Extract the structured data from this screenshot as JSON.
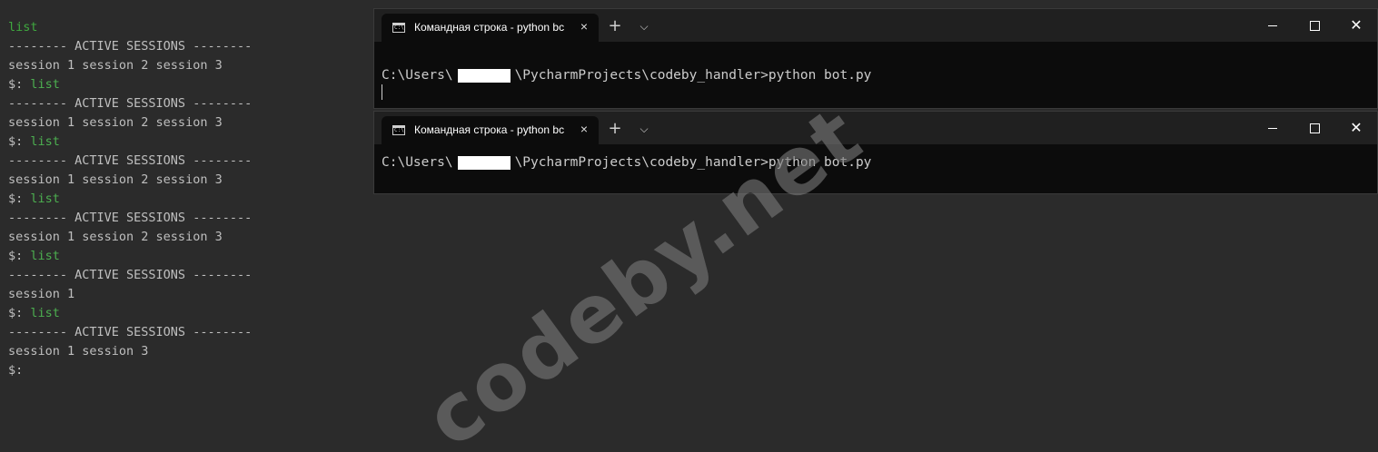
{
  "console": {
    "lines": [
      {
        "prefix": "",
        "text": "list",
        "style": "cmd-green"
      },
      {
        "prefix": "",
        "text": "-------- ACTIVE SESSIONS --------",
        "style": "plain"
      },
      {
        "prefix": "",
        "text": "session 1 session 2 session 3",
        "style": "plain"
      },
      {
        "prefix": "$: ",
        "text": "list",
        "style": "prompt"
      },
      {
        "prefix": "",
        "text": "-------- ACTIVE SESSIONS --------",
        "style": "plain"
      },
      {
        "prefix": "",
        "text": "session 1 session 2 session 3",
        "style": "plain"
      },
      {
        "prefix": "$: ",
        "text": "list",
        "style": "prompt"
      },
      {
        "prefix": "",
        "text": "-------- ACTIVE SESSIONS --------",
        "style": "plain"
      },
      {
        "prefix": "",
        "text": "session 1 session 2 session 3",
        "style": "plain"
      },
      {
        "prefix": "$: ",
        "text": "list",
        "style": "prompt"
      },
      {
        "prefix": "",
        "text": "-------- ACTIVE SESSIONS --------",
        "style": "plain"
      },
      {
        "prefix": "",
        "text": "session 1 session 2 session 3",
        "style": "plain"
      },
      {
        "prefix": "$: ",
        "text": "list",
        "style": "prompt"
      },
      {
        "prefix": "",
        "text": "-------- ACTIVE SESSIONS --------",
        "style": "plain"
      },
      {
        "prefix": "",
        "text": "session 1",
        "style": "plain"
      },
      {
        "prefix": "$: ",
        "text": "list",
        "style": "prompt"
      },
      {
        "prefix": "",
        "text": "-------- ACTIVE SESSIONS --------",
        "style": "plain"
      },
      {
        "prefix": "",
        "text": "session 1 session 3",
        "style": "plain"
      },
      {
        "prefix": "$:",
        "text": "",
        "style": "prompt"
      }
    ]
  },
  "terminals": [
    {
      "tab_title": "Командная строка - python  bc",
      "path_before": "C:\\Users\\",
      "path_after": "\\PycharmProjects\\codeby_handler>python bot.py"
    },
    {
      "tab_title": "Командная строка - python  bc",
      "path_before": "C:\\Users\\",
      "path_after": "\\PycharmProjects\\codeby_handler>python bot.py"
    }
  ],
  "icons": {
    "tab_icon": "cmd-icon",
    "tab_close": "×",
    "new_tab": "+",
    "dropdown": "⌵",
    "minimize": "minimize-icon",
    "maximize": "maximize-icon",
    "close": "✕"
  },
  "watermark": "codeby.net",
  "colors": {
    "background": "#2b2b2b",
    "terminal_bg": "#0c0c0c",
    "titlebar": "#202020",
    "command_green": "#3fa83f"
  }
}
